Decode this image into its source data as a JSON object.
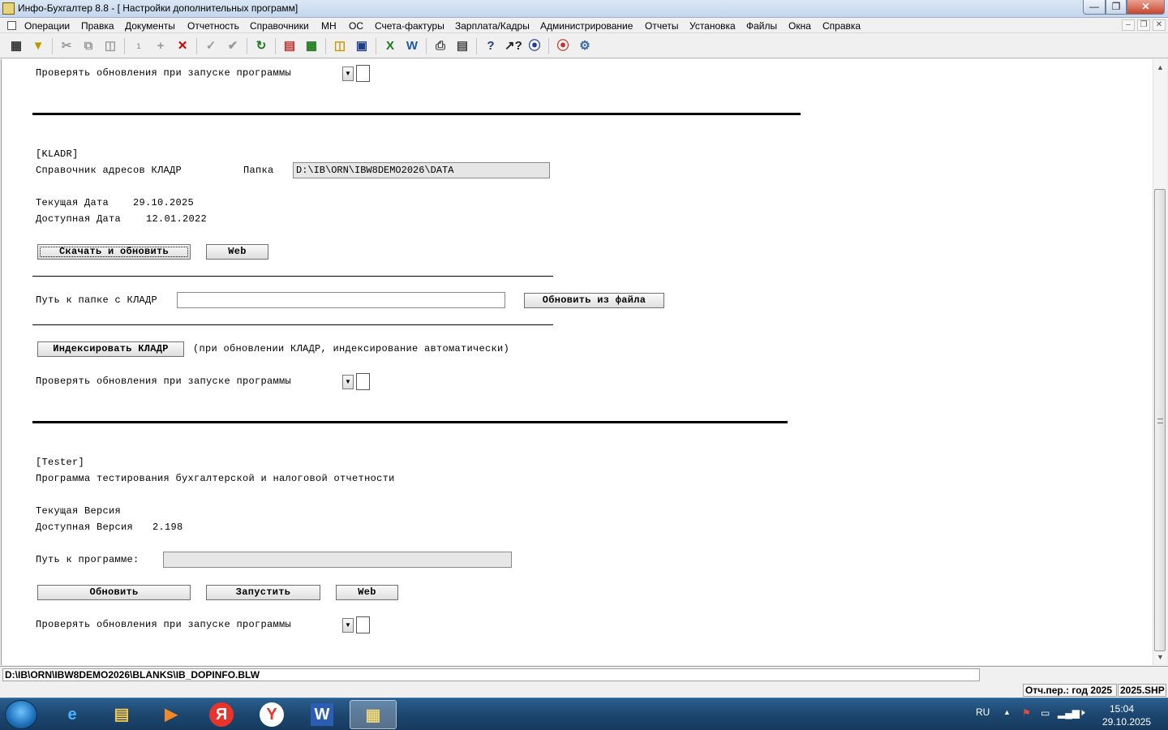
{
  "window": {
    "title": "Инфо-Бухгалтер 8.8 - [ Настройки дополнительных программ]"
  },
  "menu": [
    "Операции",
    "Правка",
    "Документы",
    "Отчетность",
    "Справочники",
    "МН",
    "ОС",
    "Счета-фактуры",
    "Зарплата/Кадры",
    "Администрирование",
    "Отчеты",
    "Установка",
    "Файлы",
    "Окна",
    "Справка"
  ],
  "toolbar_icons": [
    "grid-icon",
    "filter-icon",
    "cut-icon",
    "copy-icon",
    "paste-icon",
    "numbering-icon",
    "add-icon",
    "delete-icon",
    "pick-icon",
    "pick-all-icon",
    "refresh-icon",
    "pdf-icon",
    "calculator-icon",
    "open-folder-icon",
    "save-icon",
    "excel-icon",
    "word-icon",
    "print-icon",
    "preview-icon",
    "help-icon",
    "context-help-icon",
    "compass-icon",
    "support-icon",
    "web-settings-icon"
  ],
  "section_top": {
    "check_updates_label": "Проверять обновления при запуске программы"
  },
  "kladr": {
    "tag": "[KLADR]",
    "name": "Справочник адресов КЛАДР",
    "folder_label": "Папка",
    "folder_value": "D:\\IB\\ORN\\IBW8DEMO2026\\DATA",
    "current_date_label": "Текущая Дата",
    "current_date_value": "29.10.2025",
    "available_date_label": "Доступная Дата",
    "available_date_value": "12.01.2022",
    "download_button": "Скачать и обновить",
    "web_button": "Web",
    "path_label": "Путь к папке с КЛАДР",
    "path_value": "",
    "update_from_file_button": "Обновить из файла",
    "index_button": "Индексировать КЛАДР",
    "index_note": "(при обновлении КЛАДР, индексирование автоматически)",
    "check_updates_label": "Проверять обновления при запуске программы"
  },
  "tester": {
    "tag": "[Tester]",
    "name": "Программа тестирования бухгалтерской и налоговой отчетности",
    "current_version_label": "Текущая Версия",
    "current_version_value": "",
    "available_version_label": "Доступная Версия",
    "available_version_value": "2.198",
    "path_label": "Путь к программе:",
    "path_value": "",
    "update_button": "Обновить",
    "run_button": "Запустить",
    "web_button": "Web",
    "check_updates_label": "Проверять обновления при запуске программы"
  },
  "status": {
    "path": "D:\\IB\\ORN\\IBW8DEMO2026\\BLANKS\\IB_DOPINFO.BLW",
    "period": "Отч.пер.: год 2025",
    "file": "2025.SHP"
  },
  "taskbar": {
    "apps": [
      "ie-icon",
      "explorer-icon",
      "media-player-icon",
      "yandex-icon",
      "yandex-browser-icon",
      "word-icon",
      "infobuh-icon"
    ],
    "lang": "RU",
    "time": "15:04",
    "date": "29.10.2025"
  },
  "colors": {
    "taskbar": "#1d4770",
    "close_button": "#c8452c"
  }
}
